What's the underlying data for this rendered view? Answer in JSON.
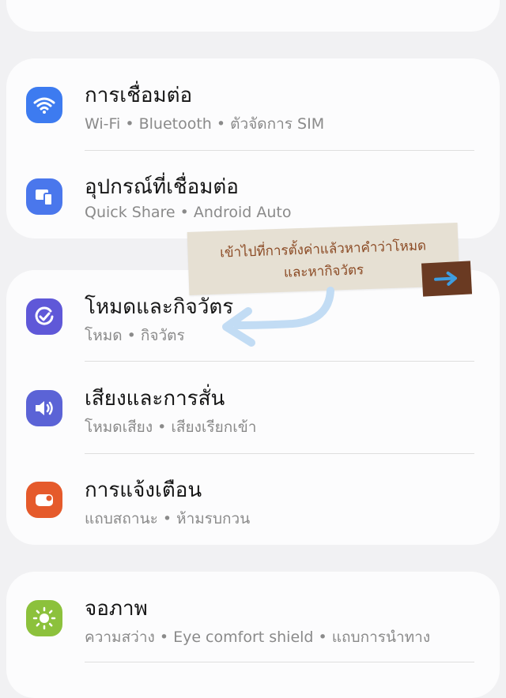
{
  "colors": {
    "wifi": "#3d7bf0",
    "devices": "#4a77ec",
    "modes": "#5f58d8",
    "sound": "#5b63d6",
    "notifications": "#e55a2b",
    "display": "#8cc13c",
    "note_bg": "#e6e0d3",
    "note_text": "#8b4a24",
    "note_arrow_bg": "#6a3a22",
    "note_arrow": "#3e9de0",
    "curve_arrow": "#c2dcf4"
  },
  "settings": [
    {
      "icon": "wifi-icon",
      "title": "การเชื่อมต่อ",
      "subtitle": "Wi-Fi • Bluetooth • ตัวจัดการ SIM"
    },
    {
      "icon": "devices-icon",
      "title": "อุปกรณ์ที่เชื่อมต่อ",
      "subtitle": "Quick Share • Android Auto"
    },
    {
      "icon": "check-circle-icon",
      "title": "โหมดและกิจวัตร",
      "subtitle": "โหมด • กิจวัตร"
    },
    {
      "icon": "speaker-icon",
      "title": "เสียงและการสั่น",
      "subtitle": "โหมดเสียง • เสียงเรียกเข้า"
    },
    {
      "icon": "notification-icon",
      "title": "การแจ้งเตือน",
      "subtitle": "แถบสถานะ • ห้ามรบกวน"
    },
    {
      "icon": "sun-icon",
      "title": "จอภาพ",
      "subtitle": "ความสว่าง • Eye comfort shield • แถบการนำทาง"
    }
  ],
  "annotation": {
    "line1": "เข้าไปที่การตั้งค่าแล้วหาคำว่าโหมด",
    "line2": "และหากิจวัตร"
  }
}
